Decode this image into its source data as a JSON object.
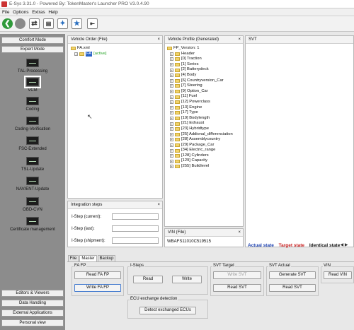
{
  "app": {
    "title": "E-Sys 3.31.0 - Powered By: TokenMaster's Launcher PRO V3.0.4.90"
  },
  "menu": [
    "File",
    "Options",
    "Extras",
    "Help"
  ],
  "sidebar": {
    "comfort_mode": "Comfort Mode",
    "expert_mode": "Expert Mode",
    "items": [
      "TAL-Processing",
      "VCM",
      "Coding",
      "Coding-Verification",
      "FSC-Extended",
      "TSL-Update",
      "NAV/ENT-Update",
      "OBD-CVN",
      "Certificate management"
    ],
    "bottom": [
      "Editors & Viewers",
      "Data Handling",
      "External Applications",
      "Personal view"
    ]
  },
  "vehicle_order": {
    "title": "Vehicle Order (File)",
    "root": "FA.xml",
    "child": "FA",
    "child_status": "[active]"
  },
  "vehicle_profile": {
    "title": "Vehicle Profile (Generated)",
    "version": "FP_Version: 1",
    "items": [
      "Header",
      "[0] Traction",
      "[1] Series",
      "[2] Batterydeck",
      "[4] Body",
      "[6] Countryversion_Car",
      "[7] Steering",
      "[9] Option_Car",
      "[11] Fuel",
      "[12] Powerclass",
      "[13] Engine",
      "[17] Type",
      "[19] Bodylength",
      "[21] Exhaust",
      "[23] Hybridtype",
      "[25] Addional_differenciation",
      "[28] Assemblycountry",
      "[29] Package_Car",
      "[34] Electric_range",
      "[128] Cylinders",
      "[129] Capacity",
      "[255] Buildlevel"
    ]
  },
  "svt": {
    "title": "SVT",
    "legend": [
      {
        "label": "Actual state",
        "color": "#1a3fb0"
      },
      {
        "label": "Target state",
        "color": "#c81e1e"
      },
      {
        "label": "Identical state",
        "color": "#111111"
      }
    ]
  },
  "integration_steps": {
    "title": "Integration steps",
    "current_label": "I-Step (current):",
    "last_label": "I-Step (last):",
    "shipment_label": "I-Step (shipment):"
  },
  "vin": {
    "title": "VIN (File)",
    "value": "WBAFS11010C519515"
  },
  "tabs": [
    "File",
    "Master",
    "Backup"
  ],
  "fa_fp": {
    "title": "FA FP",
    "read": "Read FA FP",
    "write": "Write FA FP"
  },
  "isteps": {
    "title": "I-Steps",
    "read": "Read",
    "write": "Write"
  },
  "ecu_exchange": {
    "title": "ECU exchange detection",
    "detect": "Detect exchanged ECUs"
  },
  "svt_target": {
    "title": "SVT Target",
    "write": "Write SVT",
    "read": "Read SVT"
  },
  "svt_actual": {
    "title": "SVT Actual",
    "generate": "Generate SVT",
    "read": "Read SVT"
  },
  "vin_group": {
    "title": "VIN",
    "read": "Read VIN"
  },
  "icons": [
    "arrow-left-icon",
    "stop-icon",
    "connect-icon",
    "document-icon",
    "network-icon",
    "star-icon",
    "exit-icon"
  ]
}
